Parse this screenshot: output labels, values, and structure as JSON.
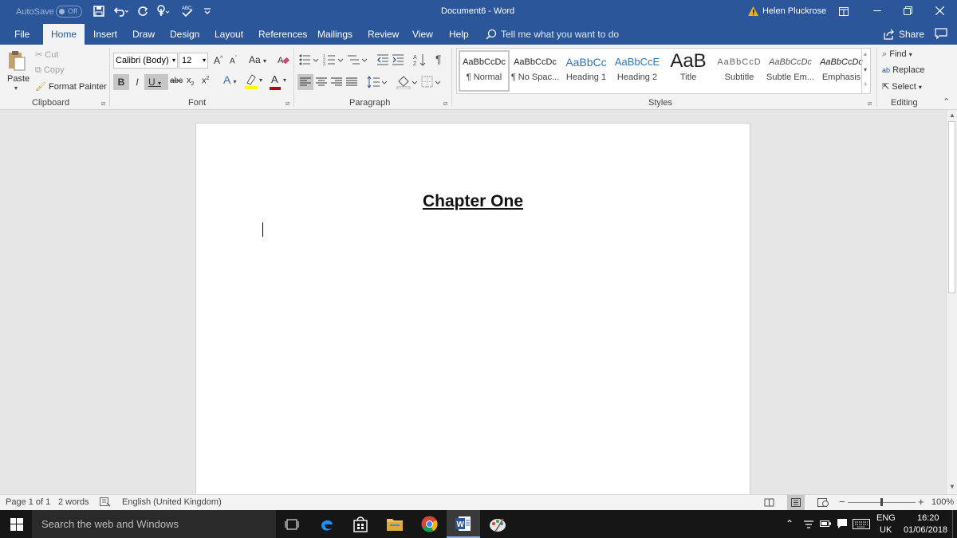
{
  "titlebar": {
    "autosave_label": "AutoSave",
    "autosave_state": "Off",
    "document_title": "Document6 - Word",
    "user_name": "Helen Pluckrose",
    "qat_icons": [
      "save-icon",
      "undo-icon",
      "redo-icon",
      "touch-mode-icon",
      "spelling-icon",
      "customize-icon"
    ]
  },
  "tabs": [
    "File",
    "Home",
    "Insert",
    "Draw",
    "Design",
    "Layout",
    "References",
    "Mailings",
    "Review",
    "View",
    "Help"
  ],
  "active_tab": "Home",
  "tell_me": "Tell me what you want to do",
  "share_label": "Share",
  "clipboard": {
    "group_label": "Clipboard",
    "paste": "Paste",
    "cut": "Cut",
    "copy": "Copy",
    "format_painter": "Format Painter"
  },
  "font": {
    "group_label": "Font",
    "family": "Calibri (Body)",
    "size": "12",
    "grow": "A",
    "shrink": "A",
    "case": "Aa",
    "bold": "B",
    "italic": "I",
    "underline": "U",
    "strike": "abc",
    "sub": "x",
    "sup": "x",
    "effects": "A",
    "color": "A",
    "highlight_color": "#ffff00",
    "font_color": "#c00000"
  },
  "paragraph": {
    "group_label": "Paragraph",
    "pilcrow": "¶"
  },
  "styles": {
    "group_label": "Styles",
    "items": [
      {
        "preview": "AaBbCcDc",
        "name": "¶ Normal"
      },
      {
        "preview": "AaBbCcDc",
        "name": "¶ No Spac..."
      },
      {
        "preview": "AaBbCc",
        "name": "Heading 1"
      },
      {
        "preview": "AaBbCcE",
        "name": "Heading 2"
      },
      {
        "preview": "AaB",
        "name": "Title"
      },
      {
        "preview": "AaBbCcD",
        "name": "Subtitle"
      },
      {
        "preview": "AaBbCcDc",
        "name": "Subtle Em..."
      },
      {
        "preview": "AaBbCcDc",
        "name": "Emphasis"
      }
    ]
  },
  "editing": {
    "group_label": "Editing",
    "find": "Find",
    "replace": "Replace",
    "select": "Select"
  },
  "document": {
    "heading": "Chapter One"
  },
  "status": {
    "page": "Page 1 of 1",
    "words": "2 words",
    "language": "English (United Kingdom)",
    "zoom": "100%",
    "zoom_minus": "−",
    "zoom_plus": "+"
  },
  "taskbar": {
    "search_placeholder": "Search the web and Windows",
    "lang_top": "ENG",
    "lang_bottom": "UK",
    "time": "16:20",
    "date": "01/06/2018"
  }
}
